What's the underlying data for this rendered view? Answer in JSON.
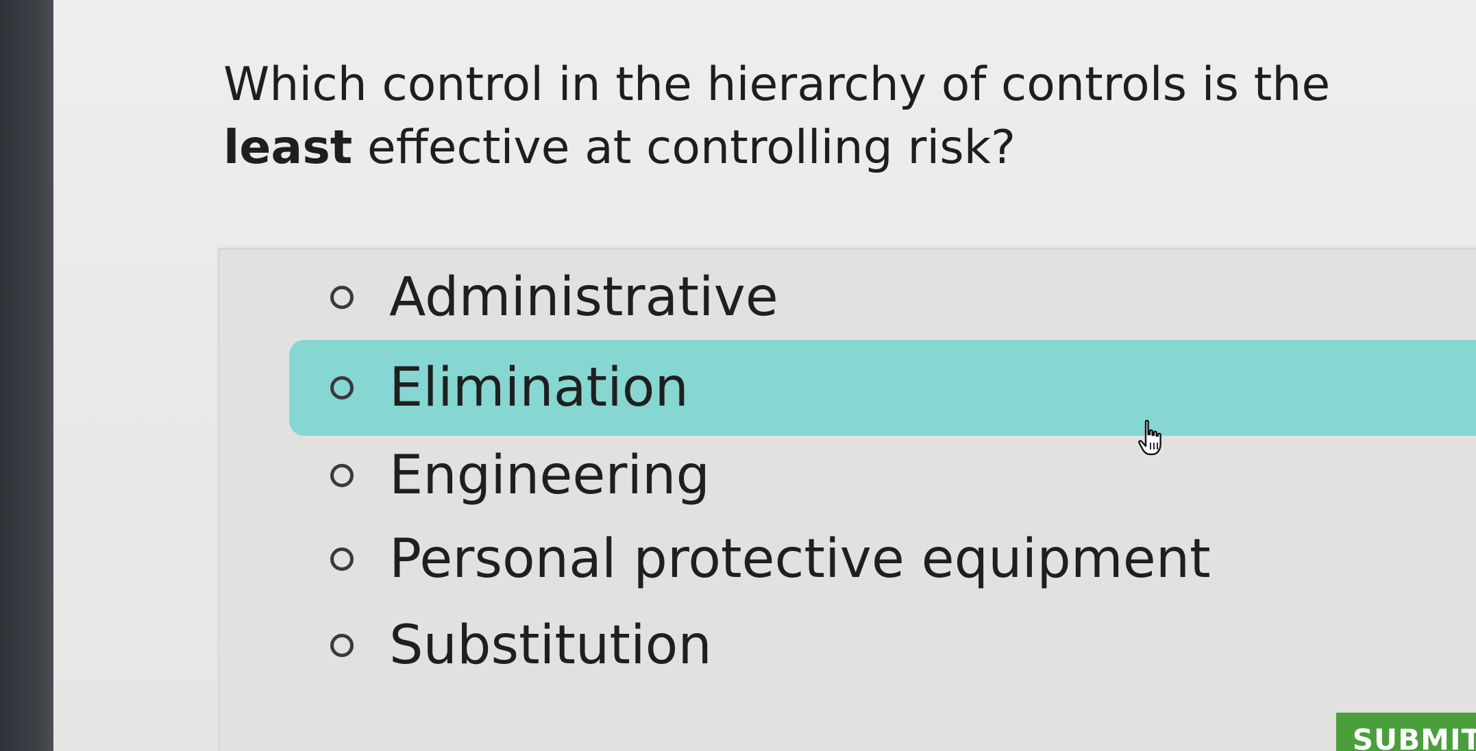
{
  "question": {
    "text_before": "Which control in the hierarchy of controls is the ",
    "emphasis": "least",
    "text_after": " effective at controlling risk?"
  },
  "options": [
    {
      "label": "Administrative",
      "selected": false,
      "highlighted": false
    },
    {
      "label": "Elimination",
      "selected": false,
      "highlighted": true
    },
    {
      "label": "Engineering",
      "selected": false,
      "highlighted": false
    },
    {
      "label": "Personal protective equipment",
      "selected": false,
      "highlighted": false
    },
    {
      "label": "Substitution",
      "selected": false,
      "highlighted": false
    }
  ],
  "submit": {
    "label": "SUBMIT"
  },
  "colors": {
    "highlight": "#86d6d2",
    "submit_bg": "#4a9e3c",
    "text": "#1f1f1f"
  },
  "icons": {
    "cursor": "hand-pointer-icon",
    "radio": "radio-unchecked-icon"
  }
}
